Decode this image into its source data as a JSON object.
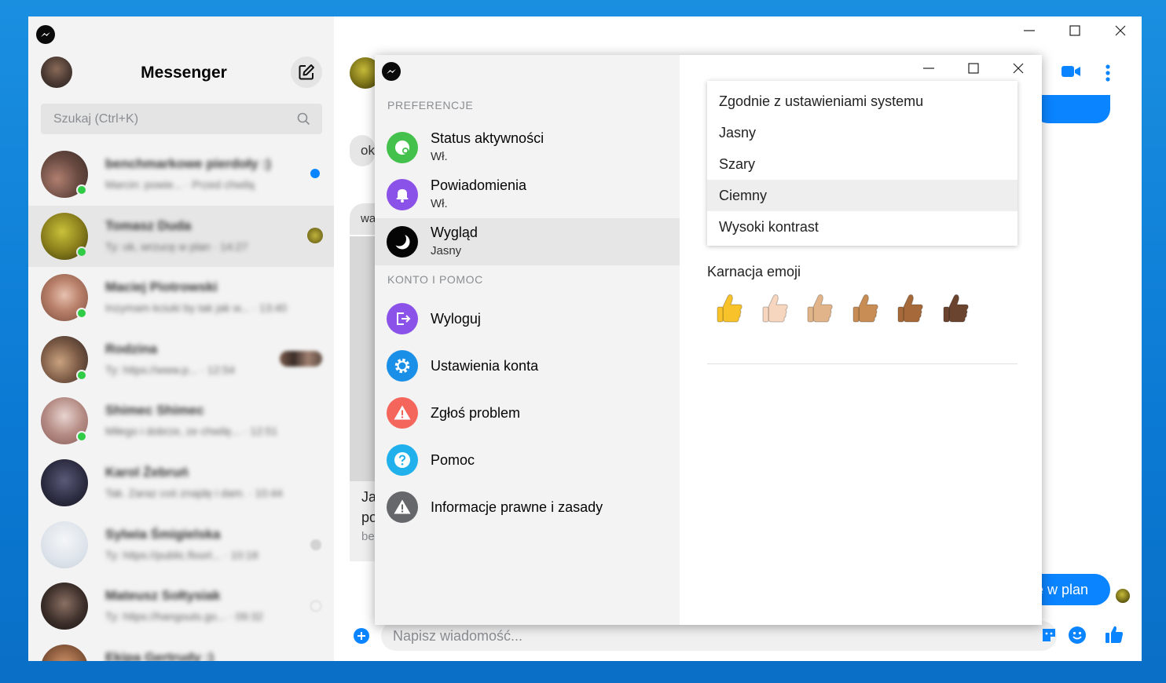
{
  "app": {
    "title": "Messenger",
    "search_placeholder": "Szukaj (Ctrl+K)"
  },
  "chats": [
    {
      "name": "benchmarkowe pierdoły :)",
      "snippet": "Marcin: powie... · Przed chwilą",
      "active": false,
      "online": true
    },
    {
      "name": "Tomasz Duda",
      "snippet": "Ty: ok, wrzucę w plan · 14:27",
      "active": true,
      "online": true
    },
    {
      "name": "Maciej Piotrowski",
      "snippet": "Inzymam kciuki by tak jak w... · 13:40",
      "active": false,
      "online": true
    },
    {
      "name": "Rodzina",
      "snippet": "Ty: https://www.p... · 12:54",
      "active": false,
      "online": true
    },
    {
      "name": "Shimec Shimec",
      "snippet": "Miłego i dobrze, ze chwilę... · 12:51",
      "active": false,
      "online": true
    },
    {
      "name": "Karol Żebruń",
      "snippet": "Tak. Zaraz coś znajdę i dam. · 10:44",
      "active": false,
      "online": false
    },
    {
      "name": "Sylwia Śmigielska",
      "snippet": "Ty: https://public.floorl... · 10:18",
      "active": false,
      "online": false
    },
    {
      "name": "Mateusz Sołtysiak",
      "snippet": "Ty: https://hangouts.go... · 09:32",
      "active": false,
      "online": false
    },
    {
      "name": "Ekipa Gertrudy :)",
      "snippet": "",
      "active": false,
      "online": false
    }
  ],
  "conversation": {
    "bubble_1": "ok",
    "bubble_2": "wa",
    "card_title_1": "Ja",
    "card_title_2": "po",
    "card_sub": "be",
    "sent_message": "ę w plan",
    "composer_placeholder": "Napisz wiadomość..."
  },
  "settings": {
    "section_preferences": "PREFERENCJE",
    "section_account": "KONTO I POMOC",
    "items": [
      {
        "title": "Status aktywności",
        "subtitle": "Wł.",
        "icon": "activity-status-icon",
        "color": "#44c14d"
      },
      {
        "title": "Powiadomienia",
        "subtitle": "Wł.",
        "icon": "bell-icon",
        "color": "#8a52e8"
      },
      {
        "title": "Wygląd",
        "subtitle": "Jasny",
        "icon": "moon-icon",
        "color": "#050505"
      },
      {
        "title": "Wyloguj",
        "icon": "logout-icon",
        "color": "#8a52e8"
      },
      {
        "title": "Ustawienia konta",
        "icon": "gear-icon",
        "color": "#1a8fe8"
      },
      {
        "title": "Zgłoś problem",
        "icon": "warning-icon",
        "color": "#f4665c"
      },
      {
        "title": "Pomoc",
        "icon": "help-icon",
        "color": "#20b0ec"
      },
      {
        "title": "Informacje prawne i zasady",
        "icon": "legal-warning-icon",
        "color": "#65676b"
      }
    ],
    "theme_options": [
      "Zgodnie z ustawieniami systemu",
      "Jasny",
      "Szary",
      "Ciemny",
      "Wysoki kontrast"
    ],
    "theme_hovered": "Ciemny",
    "emoji_label": "Karnacja emoji",
    "skin_tones": [
      "#f8c22a",
      "#f6d6bf",
      "#e2b48a",
      "#c78d55",
      "#a5693a",
      "#6b4430"
    ]
  },
  "colors": {
    "brand_blue": "#0b84ff",
    "online_green": "#31cc46"
  }
}
